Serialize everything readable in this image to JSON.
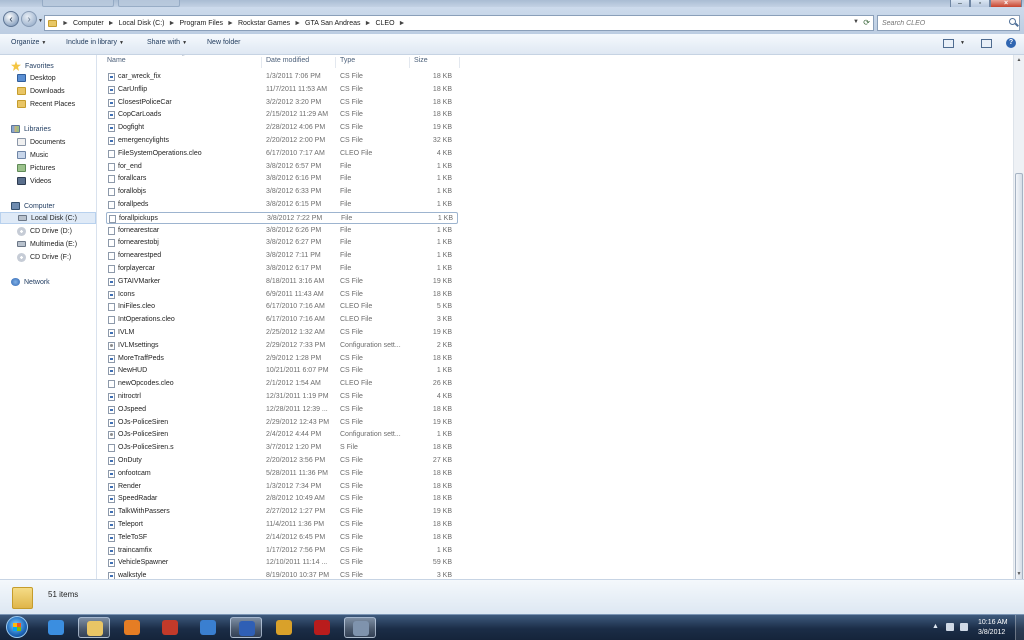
{
  "address": {
    "crumbs": [
      "Computer",
      "Local Disk (C:)",
      "Program Files",
      "Rockstar Games",
      "GTA San Andreas",
      "CLEO"
    ]
  },
  "search": {
    "placeholder": "Search CLEO"
  },
  "toolbar": {
    "organize": "Organize",
    "include_in_library": "Include in library",
    "share_with": "Share with",
    "new_folder": "New folder"
  },
  "nav": {
    "items": [
      {
        "label": "Favorites",
        "icon": "star-icon",
        "group": true
      },
      {
        "label": "Desktop",
        "icon": "desktop-icon"
      },
      {
        "label": "Downloads",
        "icon": "downloads-icon"
      },
      {
        "label": "Recent Places",
        "icon": "recent-places-icon"
      },
      {
        "label": "Libraries",
        "icon": "libraries-icon",
        "group": true
      },
      {
        "label": "Documents",
        "icon": "documents-icon"
      },
      {
        "label": "Music",
        "icon": "music-icon"
      },
      {
        "label": "Pictures",
        "icon": "pictures-icon"
      },
      {
        "label": "Videos",
        "icon": "videos-icon"
      },
      {
        "label": "Computer",
        "icon": "computer-icon",
        "group": true
      },
      {
        "label": "Local Disk (C:)",
        "icon": "hard-disk-icon",
        "selected": true
      },
      {
        "label": "CD Drive (D:)",
        "icon": "cd-drive-icon"
      },
      {
        "label": "Multimedia (E:)",
        "icon": "hard-disk-icon"
      },
      {
        "label": "CD Drive (F:)",
        "icon": "cd-drive-icon"
      },
      {
        "label": "Network",
        "icon": "network-icon",
        "group": true
      }
    ]
  },
  "columns": {
    "name": "Name",
    "date": "Date modified",
    "type": "Type",
    "size": "Size"
  },
  "files": [
    {
      "name": "car_wreck_fix",
      "date": "1/3/2011 7:06 PM",
      "type": "CS File",
      "size": "18 KB",
      "icon": "cs"
    },
    {
      "name": "CarUnflip",
      "date": "11/7/2011 11:53 AM",
      "type": "CS File",
      "size": "18 KB",
      "icon": "cs"
    },
    {
      "name": "ClosestPoliceCar",
      "date": "3/2/2012 3:20 PM",
      "type": "CS File",
      "size": "18 KB",
      "icon": "cs"
    },
    {
      "name": "CopCarLoads",
      "date": "2/15/2012 11:29 AM",
      "type": "CS File",
      "size": "18 KB",
      "icon": "cs"
    },
    {
      "name": "Dogfight",
      "date": "2/28/2012 4:06 PM",
      "type": "CS File",
      "size": "19 KB",
      "icon": "cs"
    },
    {
      "name": "emergencylights",
      "date": "2/20/2012 2:00 PM",
      "type": "CS File",
      "size": "32 KB",
      "icon": "cs"
    },
    {
      "name": "FileSystemOperations.cleo",
      "date": "6/17/2010 7:17 AM",
      "type": "CLEO File",
      "size": "4 KB",
      "icon": "blank"
    },
    {
      "name": "for_end",
      "date": "3/8/2012 6:57 PM",
      "type": "File",
      "size": "1 KB",
      "icon": "blank"
    },
    {
      "name": "forallcars",
      "date": "3/8/2012 6:16 PM",
      "type": "File",
      "size": "1 KB",
      "icon": "blank"
    },
    {
      "name": "forallobjs",
      "date": "3/8/2012 6:33 PM",
      "type": "File",
      "size": "1 KB",
      "icon": "blank"
    },
    {
      "name": "forallpeds",
      "date": "3/8/2012 6:15 PM",
      "type": "File",
      "size": "1 KB",
      "icon": "blank"
    },
    {
      "name": "forallpickups",
      "date": "3/8/2012 7:22 PM",
      "type": "File",
      "size": "1 KB",
      "icon": "blank",
      "focused": true
    },
    {
      "name": "fornearestcar",
      "date": "3/8/2012 6:26 PM",
      "type": "File",
      "size": "1 KB",
      "icon": "blank"
    },
    {
      "name": "fornearestobj",
      "date": "3/8/2012 6:27 PM",
      "type": "File",
      "size": "1 KB",
      "icon": "blank"
    },
    {
      "name": "fornearestped",
      "date": "3/8/2012 7:11 PM",
      "type": "File",
      "size": "1 KB",
      "icon": "blank"
    },
    {
      "name": "forplayercar",
      "date": "3/8/2012 6:17 PM",
      "type": "File",
      "size": "1 KB",
      "icon": "blank"
    },
    {
      "name": "GTAIVMarker",
      "date": "8/18/2011 3:16 AM",
      "type": "CS File",
      "size": "19 KB",
      "icon": "cs"
    },
    {
      "name": "Icons",
      "date": "6/9/2011 11:43 AM",
      "type": "CS File",
      "size": "18 KB",
      "icon": "cs"
    },
    {
      "name": "IniFiles.cleo",
      "date": "6/17/2010 7:16 AM",
      "type": "CLEO File",
      "size": "5 KB",
      "icon": "blank"
    },
    {
      "name": "IntOperations.cleo",
      "date": "6/17/2010 7:16 AM",
      "type": "CLEO File",
      "size": "3 KB",
      "icon": "blank"
    },
    {
      "name": "IVLM",
      "date": "2/25/2012 1:32 AM",
      "type": "CS File",
      "size": "19 KB",
      "icon": "cs"
    },
    {
      "name": "IVLMsettings",
      "date": "2/29/2012 7:33 PM",
      "type": "Configuration sett...",
      "size": "2 KB",
      "icon": "cfg"
    },
    {
      "name": "MoreTraffPeds",
      "date": "2/9/2012 1:28 PM",
      "type": "CS File",
      "size": "18 KB",
      "icon": "cs"
    },
    {
      "name": "NewHUD",
      "date": "10/21/2011 6:07 PM",
      "type": "CS File",
      "size": "1 KB",
      "icon": "cs"
    },
    {
      "name": "newOpcodes.cleo",
      "date": "2/1/2012 1:54 AM",
      "type": "CLEO File",
      "size": "26 KB",
      "icon": "blank"
    },
    {
      "name": "nitroctrl",
      "date": "12/31/2011 1:19 PM",
      "type": "CS File",
      "size": "4 KB",
      "icon": "cs"
    },
    {
      "name": "OJspeed",
      "date": "12/28/2011 12:39 ...",
      "type": "CS File",
      "size": "18 KB",
      "icon": "cs"
    },
    {
      "name": "OJs-PoliceSiren",
      "date": "2/29/2012 12:43 PM",
      "type": "CS File",
      "size": "19 KB",
      "icon": "cs"
    },
    {
      "name": "OJs-PoliceSiren",
      "date": "2/4/2012 4:44 PM",
      "type": "Configuration sett...",
      "size": "1 KB",
      "icon": "cfg"
    },
    {
      "name": "OJs-PoliceSiren.s",
      "date": "3/7/2012 1:20 PM",
      "type": "S File",
      "size": "18 KB",
      "icon": "blank"
    },
    {
      "name": "OnDuty",
      "date": "2/20/2012 3:56 PM",
      "type": "CS File",
      "size": "27 KB",
      "icon": "cs"
    },
    {
      "name": "onfootcam",
      "date": "5/28/2011 11:36 PM",
      "type": "CS File",
      "size": "18 KB",
      "icon": "cs"
    },
    {
      "name": "Render",
      "date": "1/3/2012 7:34 PM",
      "type": "CS File",
      "size": "18 KB",
      "icon": "cs"
    },
    {
      "name": "SpeedRadar",
      "date": "2/8/2012 10:49 AM",
      "type": "CS File",
      "size": "18 KB",
      "icon": "cs"
    },
    {
      "name": "TalkWithPassers",
      "date": "2/27/2012 1:27 PM",
      "type": "CS File",
      "size": "19 KB",
      "icon": "cs"
    },
    {
      "name": "Teleport",
      "date": "11/4/2011 1:36 PM",
      "type": "CS File",
      "size": "18 KB",
      "icon": "cs"
    },
    {
      "name": "TeleToSF",
      "date": "2/14/2012 6:45 PM",
      "type": "CS File",
      "size": "18 KB",
      "icon": "cs"
    },
    {
      "name": "traincamfix",
      "date": "1/17/2012 7:56 PM",
      "type": "CS File",
      "size": "1 KB",
      "icon": "cs"
    },
    {
      "name": "VehicleSpawner",
      "date": "12/10/2011 11:14 ...",
      "type": "CS File",
      "size": "59 KB",
      "icon": "cs"
    },
    {
      "name": "walkstyle",
      "date": "8/19/2010 10:37 PM",
      "type": "CS File",
      "size": "3 KB",
      "icon": "cs"
    }
  ],
  "details": {
    "item_count": "51 items"
  },
  "taskbar": {
    "items": [
      {
        "icon": "internet-explorer-icon",
        "color": "#3b8ee0"
      },
      {
        "icon": "file-explorer-icon",
        "color": "#e9c565",
        "active": true
      },
      {
        "icon": "media-player-icon",
        "color": "#e57d24"
      },
      {
        "icon": "app-red-icon",
        "color": "#c23a2a"
      },
      {
        "icon": "app-blue-figure-icon",
        "color": "#3a7fd0"
      },
      {
        "icon": "word-icon",
        "color": "#2f5fb5",
        "active": true
      },
      {
        "icon": "app-yellow-red-icon",
        "color": "#d9a12a"
      },
      {
        "icon": "app-red-black-icon",
        "color": "#b91c1c"
      },
      {
        "icon": "app-gray-window-icon",
        "color": "#7f93ad",
        "active": true
      }
    ],
    "tray_show_hidden": "▲",
    "tray_icons": [
      {
        "icon": "network-tray-icon",
        "color": "#cfd9e6"
      },
      {
        "icon": "volume-tray-icon",
        "color": "#cfd9e6"
      }
    ],
    "time": "10:16 AM",
    "date": "3/8/2012"
  }
}
